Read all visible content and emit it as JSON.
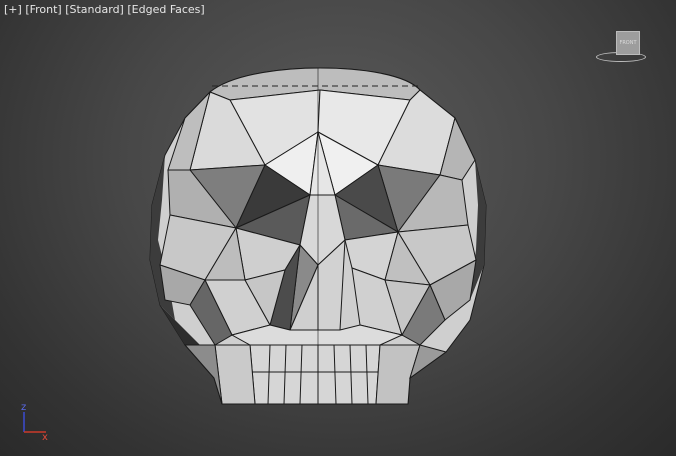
{
  "viewport": {
    "label_parts": [
      "[+]",
      "[Front]",
      "[Standard]",
      "[Edged Faces]"
    ]
  },
  "viewcube": {
    "face_label": "FRONT"
  },
  "axis": {
    "up_label": "z",
    "right_label": "x"
  },
  "colors": {
    "x_axis": "#cc3a2a",
    "z_axis": "#3c4bd0",
    "face_light": "#e4e4e4",
    "face_shade": "#4a4a4a"
  }
}
